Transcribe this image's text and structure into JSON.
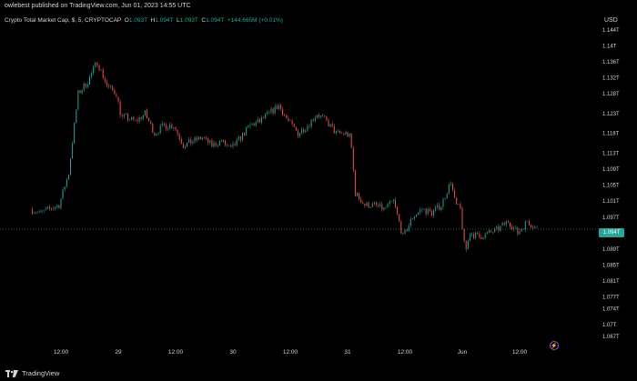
{
  "header": {
    "published_text": "owlebest published on TradingView.com, Jun 01, 2023 14:55 UTC"
  },
  "legend": {
    "symbol": "Crypto Total Market Cap, $, 5, CRYPTOCAP",
    "o_label": "O",
    "o_value": "1.093T",
    "h_label": "H",
    "h_value": "1.094T",
    "l_label": "L",
    "l_value": "1.093T",
    "c_label": "C",
    "c_value": "1.094T",
    "change": "+144.665M (+0.01%)"
  },
  "axis": {
    "currency": "USD",
    "current_price_label": "1.094T"
  },
  "footer": {
    "brand": "TradingView"
  },
  "icons": {
    "logo": "tradingview-logo-icon",
    "bolt": "lightning-bolt-icon"
  },
  "colors": {
    "background": "#000000",
    "up": "#26a69a",
    "down": "#ef5350",
    "text": "#d1d4dc",
    "current_price": "#26a69a",
    "bolt": "#b45cff"
  },
  "chart_data": {
    "type": "line",
    "title": "Crypto Total Market Cap, $, 5, CRYPTOCAP",
    "xlabel": "",
    "ylabel": "",
    "ylim": [
      1.065,
      1.146
    ],
    "y_ticks": [
      "1.144T",
      "1.14T",
      "1.136T",
      "1.132T",
      "1.128T",
      "1.123T",
      "1.118T",
      "1.113T",
      "1.109T",
      "1.105T",
      "1.101T",
      "1.097T",
      "1.089T",
      "1.085T",
      "1.081T",
      "1.077T",
      "1.074T",
      "1.07T",
      "1.067T"
    ],
    "y_tick_values": [
      1.144,
      1.14,
      1.136,
      1.132,
      1.128,
      1.123,
      1.118,
      1.113,
      1.109,
      1.105,
      1.101,
      1.097,
      1.089,
      1.085,
      1.081,
      1.077,
      1.074,
      1.07,
      1.067
    ],
    "x_ticks": [
      "12:00",
      "29",
      "12:00",
      "30",
      "12:00",
      "31",
      "12:00",
      "Jun",
      "12:00"
    ],
    "x_tick_hours": [
      12,
      24,
      36,
      48,
      60,
      72,
      84,
      96,
      108
    ],
    "current_price": 1.094,
    "grid": false,
    "series": [
      {
        "hours": [
          6,
          8,
          10,
          12,
          14,
          16,
          18,
          20,
          22,
          24,
          25,
          26,
          28,
          30,
          32,
          34,
          36,
          38,
          40,
          42,
          44,
          46,
          48,
          50,
          52,
          54,
          56,
          58,
          60,
          62,
          64,
          66,
          68,
          70,
          72,
          73,
          74,
          76,
          78,
          80,
          82,
          84,
          86,
          88,
          90,
          92,
          94,
          95,
          96,
          97,
          98,
          100,
          102,
          104,
          106,
          108,
          110,
          112
        ],
        "values": [
          1.099,
          1.098,
          1.099,
          1.1,
          1.108,
          1.128,
          1.131,
          1.136,
          1.13,
          1.128,
          1.122,
          1.122,
          1.121,
          1.123,
          1.118,
          1.12,
          1.12,
          1.115,
          1.116,
          1.117,
          1.115,
          1.116,
          1.114,
          1.117,
          1.12,
          1.121,
          1.123,
          1.125,
          1.121,
          1.118,
          1.12,
          1.123,
          1.121,
          1.118,
          1.118,
          1.117,
          1.103,
          1.1,
          1.1,
          1.099,
          1.101,
          1.092,
          1.097,
          1.099,
          1.098,
          1.1,
          1.106,
          1.1,
          1.099,
          1.088,
          1.093,
          1.092,
          1.093,
          1.094,
          1.096,
          1.093,
          1.096,
          1.094
        ]
      }
    ]
  }
}
